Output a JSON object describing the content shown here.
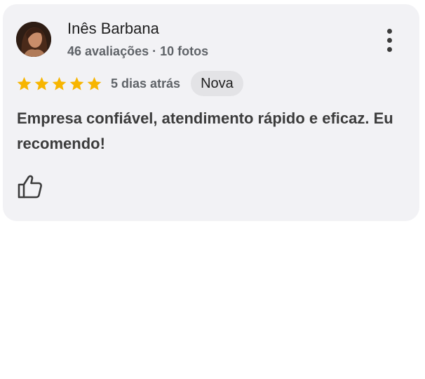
{
  "review": {
    "reviewer_name": "Inês Barbana",
    "reviewer_meta": "46 avaliações · 10 fotos",
    "rating": 5,
    "rating_max": 5,
    "time_ago": "5 dias atrás",
    "badge": "Nova",
    "text": "Empresa confiável, atendimento rápido e eficaz. Eu recomendo!",
    "icons": {
      "menu": "more-vert-icon",
      "like": "thumbs-up-icon",
      "star": "star-icon"
    },
    "colors": {
      "star": "#f7b500",
      "card_background": "#f2f2f5",
      "badge_background": "#e3e3e6"
    }
  }
}
